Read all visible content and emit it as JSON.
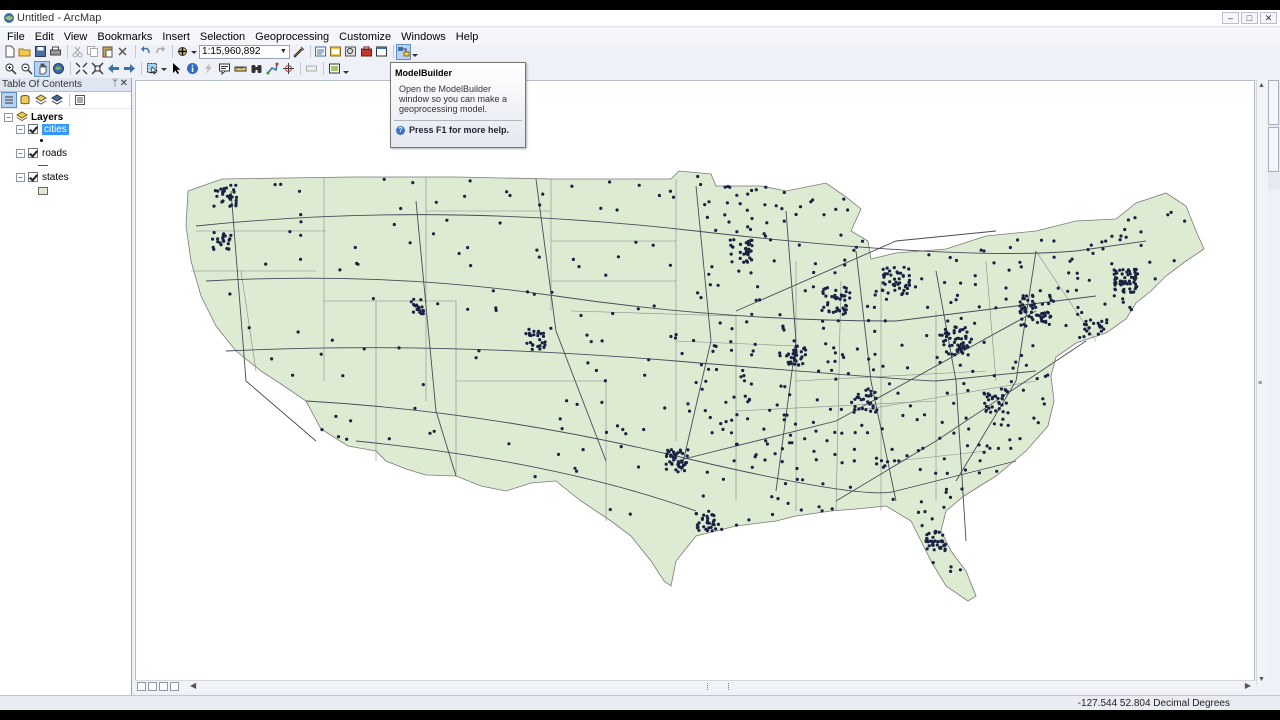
{
  "window": {
    "title": "Untitled - ArcMap"
  },
  "menu": [
    "File",
    "Edit",
    "View",
    "Bookmarks",
    "Insert",
    "Selection",
    "Geoprocessing",
    "Customize",
    "Windows",
    "Help"
  ],
  "toolbar": {
    "scale": "1:15,960,892"
  },
  "toc": {
    "title": "Table Of Contents",
    "root": "Layers",
    "layers": [
      {
        "name": "cities",
        "checked": true,
        "selected": true
      },
      {
        "name": "roads",
        "checked": true,
        "selected": false
      },
      {
        "name": "states",
        "checked": true,
        "selected": false
      }
    ]
  },
  "tooltip": {
    "title": "ModelBuilder",
    "body": "Open the ModelBuilder window so you can make a geoprocessing model.",
    "help": "Press F1 for more help."
  },
  "statusbar": {
    "coordinates": "-127.544  52.804 Decimal Degrees"
  },
  "colors": {
    "state_fill": "#dcebd2",
    "city_dot": "#1a2244",
    "selection": "#3399ff"
  }
}
